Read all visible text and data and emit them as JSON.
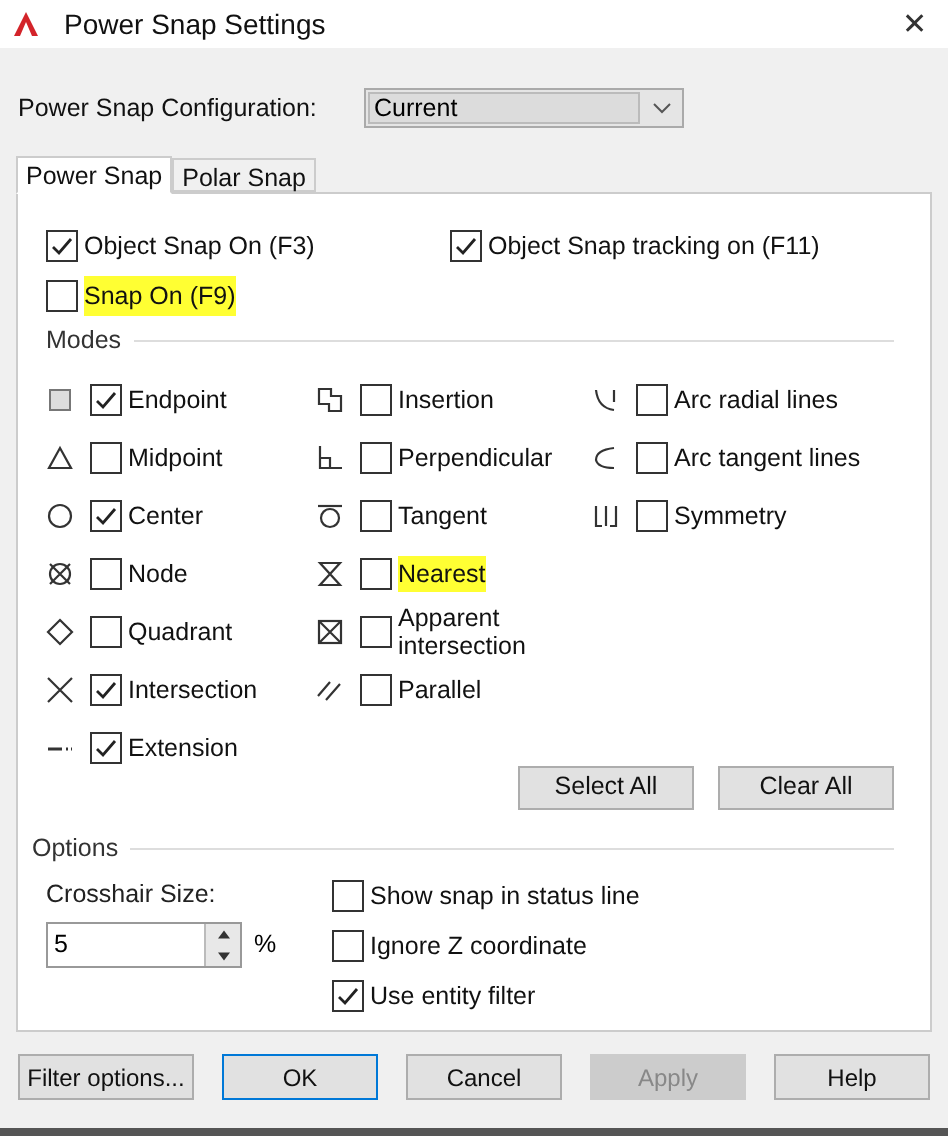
{
  "window": {
    "title": "Power Snap Settings",
    "close": "✕"
  },
  "configuration": {
    "label": "Power Snap Configuration:",
    "value": "Current"
  },
  "tabs": [
    {
      "label": "Power Snap",
      "selected": true
    },
    {
      "label": "Polar Snap",
      "selected": false
    }
  ],
  "top_options": [
    {
      "label": "Object Snap On (F3)",
      "checked": true,
      "highlighted": false
    },
    {
      "label": "Object Snap tracking on (F11)",
      "checked": true,
      "highlighted": false
    },
    {
      "label": "Snap On (F9)",
      "checked": false,
      "highlighted": true
    }
  ],
  "modes": {
    "title": "Modes",
    "columns": [
      [
        {
          "label": "Endpoint",
          "checked": true,
          "highlighted": false
        },
        {
          "label": "Midpoint",
          "checked": false,
          "highlighted": false
        },
        {
          "label": "Center",
          "checked": true,
          "highlighted": false
        },
        {
          "label": "Node",
          "checked": false,
          "highlighted": false
        },
        {
          "label": "Quadrant",
          "checked": false,
          "highlighted": false
        },
        {
          "label": "Intersection",
          "checked": true,
          "highlighted": false
        },
        {
          "label": "Extension",
          "checked": true,
          "highlighted": false
        }
      ],
      [
        {
          "label": "Insertion",
          "checked": false,
          "highlighted": false
        },
        {
          "label": "Perpendicular",
          "checked": false,
          "highlighted": false
        },
        {
          "label": "Tangent",
          "checked": false,
          "highlighted": false
        },
        {
          "label": "Nearest",
          "checked": false,
          "highlighted": true
        },
        {
          "label": "Apparent intersection",
          "checked": false,
          "highlighted": false
        },
        {
          "label": "Parallel",
          "checked": false,
          "highlighted": false
        }
      ],
      [
        {
          "label": "Arc radial lines",
          "checked": false,
          "highlighted": false
        },
        {
          "label": "Arc tangent lines",
          "checked": false,
          "highlighted": false
        },
        {
          "label": "Symmetry",
          "checked": false,
          "highlighted": false
        }
      ]
    ],
    "buttons": [
      "Select All",
      "Clear All"
    ]
  },
  "options": {
    "title": "Options",
    "crosshair_label": "Crosshair Size:",
    "crosshair_value": "5",
    "unit": "%",
    "checks": [
      {
        "label": "Show snap in status line",
        "checked": false
      },
      {
        "label": "Ignore Z coordinate",
        "checked": false
      },
      {
        "label": "Use entity filter",
        "checked": true
      }
    ]
  },
  "buttons": [
    {
      "label": "Filter options...",
      "default": false,
      "disabled": false
    },
    {
      "label": "OK",
      "default": true,
      "disabled": false
    },
    {
      "label": "Cancel",
      "default": false,
      "disabled": false
    },
    {
      "label": "Apply",
      "default": false,
      "disabled": true
    },
    {
      "label": "Help",
      "default": false,
      "disabled": false
    }
  ]
}
